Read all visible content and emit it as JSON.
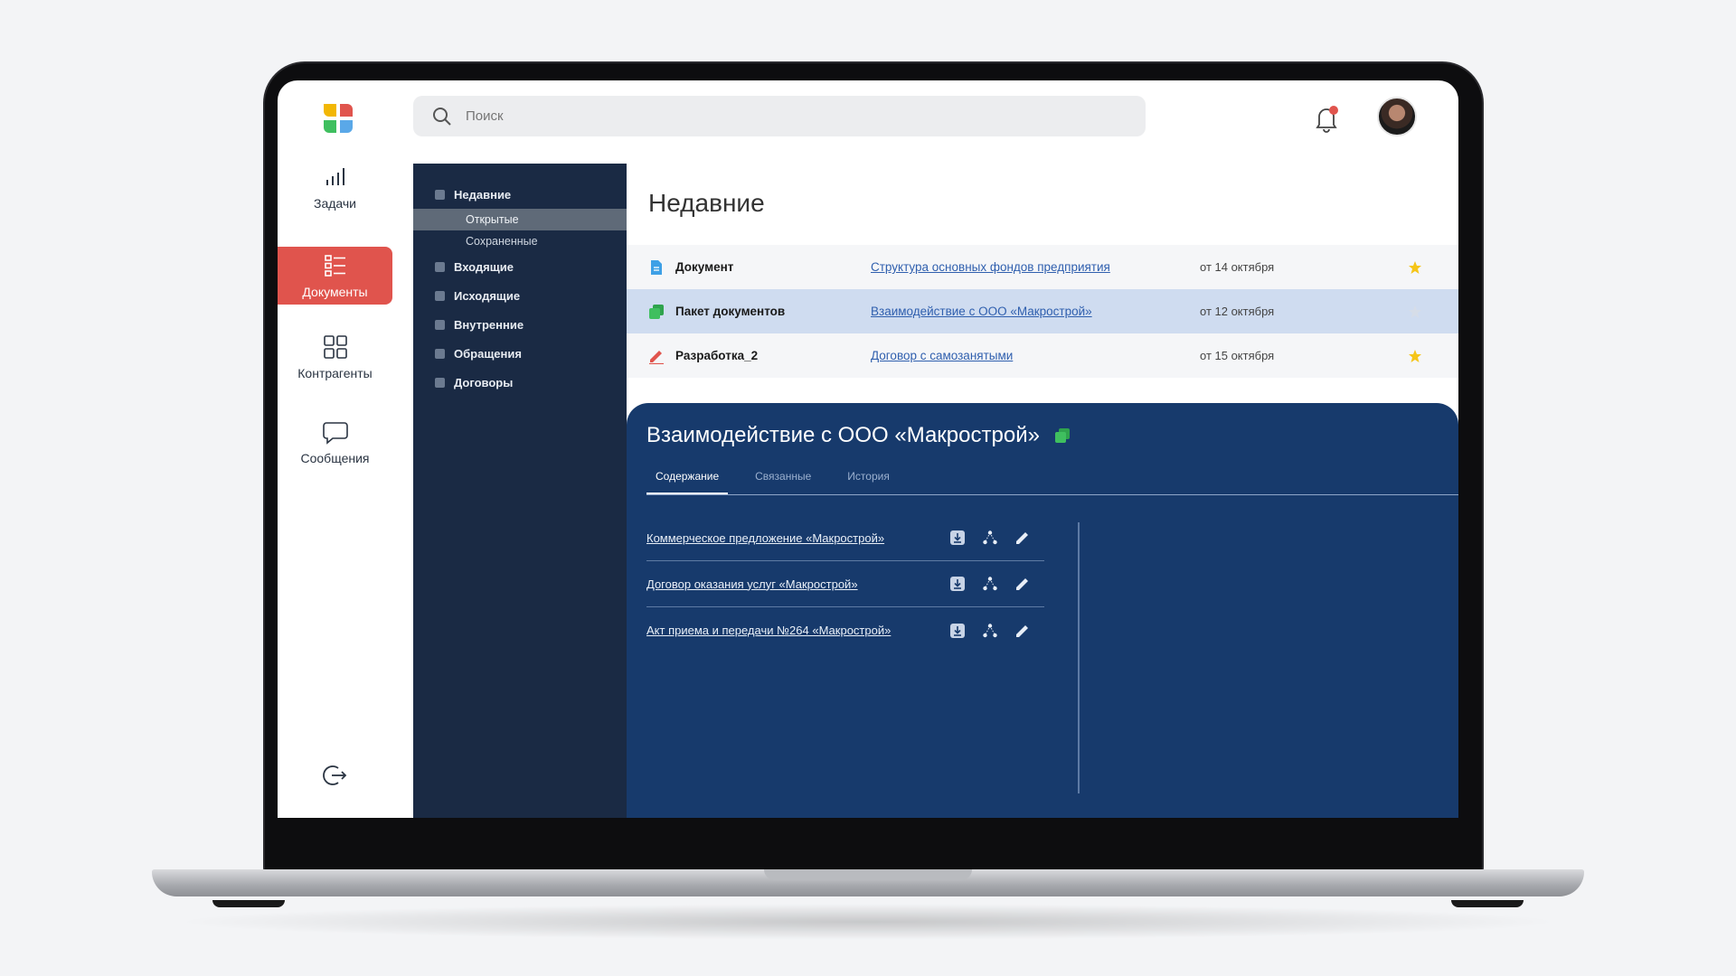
{
  "search": {
    "placeholder": "Поиск"
  },
  "rail": {
    "items": [
      {
        "label": "Задачи",
        "icon": "chart-bars-icon"
      },
      {
        "label": "Документы",
        "icon": "documents-list-icon",
        "active": true
      },
      {
        "label": "Контрагенты",
        "icon": "grid-icon"
      },
      {
        "label": "Сообщения",
        "icon": "message-bubble-icon"
      }
    ],
    "logout_icon": "logout-icon"
  },
  "tree": {
    "items": [
      {
        "label": "Недавние",
        "expanded": true,
        "children": [
          {
            "label": "Открытые",
            "active": true
          },
          {
            "label": "Сохраненные"
          }
        ]
      },
      {
        "label": "Входящие"
      },
      {
        "label": "Исходящие"
      },
      {
        "label": "Внутренние"
      },
      {
        "label": "Обращения"
      },
      {
        "label": "Договоры"
      }
    ]
  },
  "main": {
    "title": "Недавние",
    "rows": [
      {
        "type": "Документ",
        "link": "Структура основных фондов предприятия",
        "date": "от 14 октября",
        "starred": true,
        "icon_color": "#3ea0e6"
      },
      {
        "type": "Пакет документов",
        "link": "Взаимодействие с ООО «Макрострой»",
        "date": "от 12 октября",
        "starred": false,
        "icon_color": "#3fbf5f"
      },
      {
        "type": "Разработка_2",
        "link": "Договор с самозанятыми",
        "date": "от 15 октября",
        "starred": true,
        "icon_color": "#e0544d"
      }
    ]
  },
  "detail": {
    "title": "Взаимодействие с ООО «Макрострой»",
    "tabs": [
      {
        "label": "Содержание",
        "active": true
      },
      {
        "label": "Связанные"
      },
      {
        "label": "История"
      }
    ],
    "files": [
      {
        "label": "Коммерческое предложение «Макрострой»"
      },
      {
        "label": "Договор оказания услуг «Макрострой»"
      },
      {
        "label": "Акт приема и передачи №264 «Макрострой»"
      }
    ]
  },
  "colors": {
    "accent": "#e0544d",
    "panel_dark": "#1a2a44",
    "detail_bg": "#173a6c",
    "link": "#2f5fae",
    "star": "#f5c518"
  }
}
